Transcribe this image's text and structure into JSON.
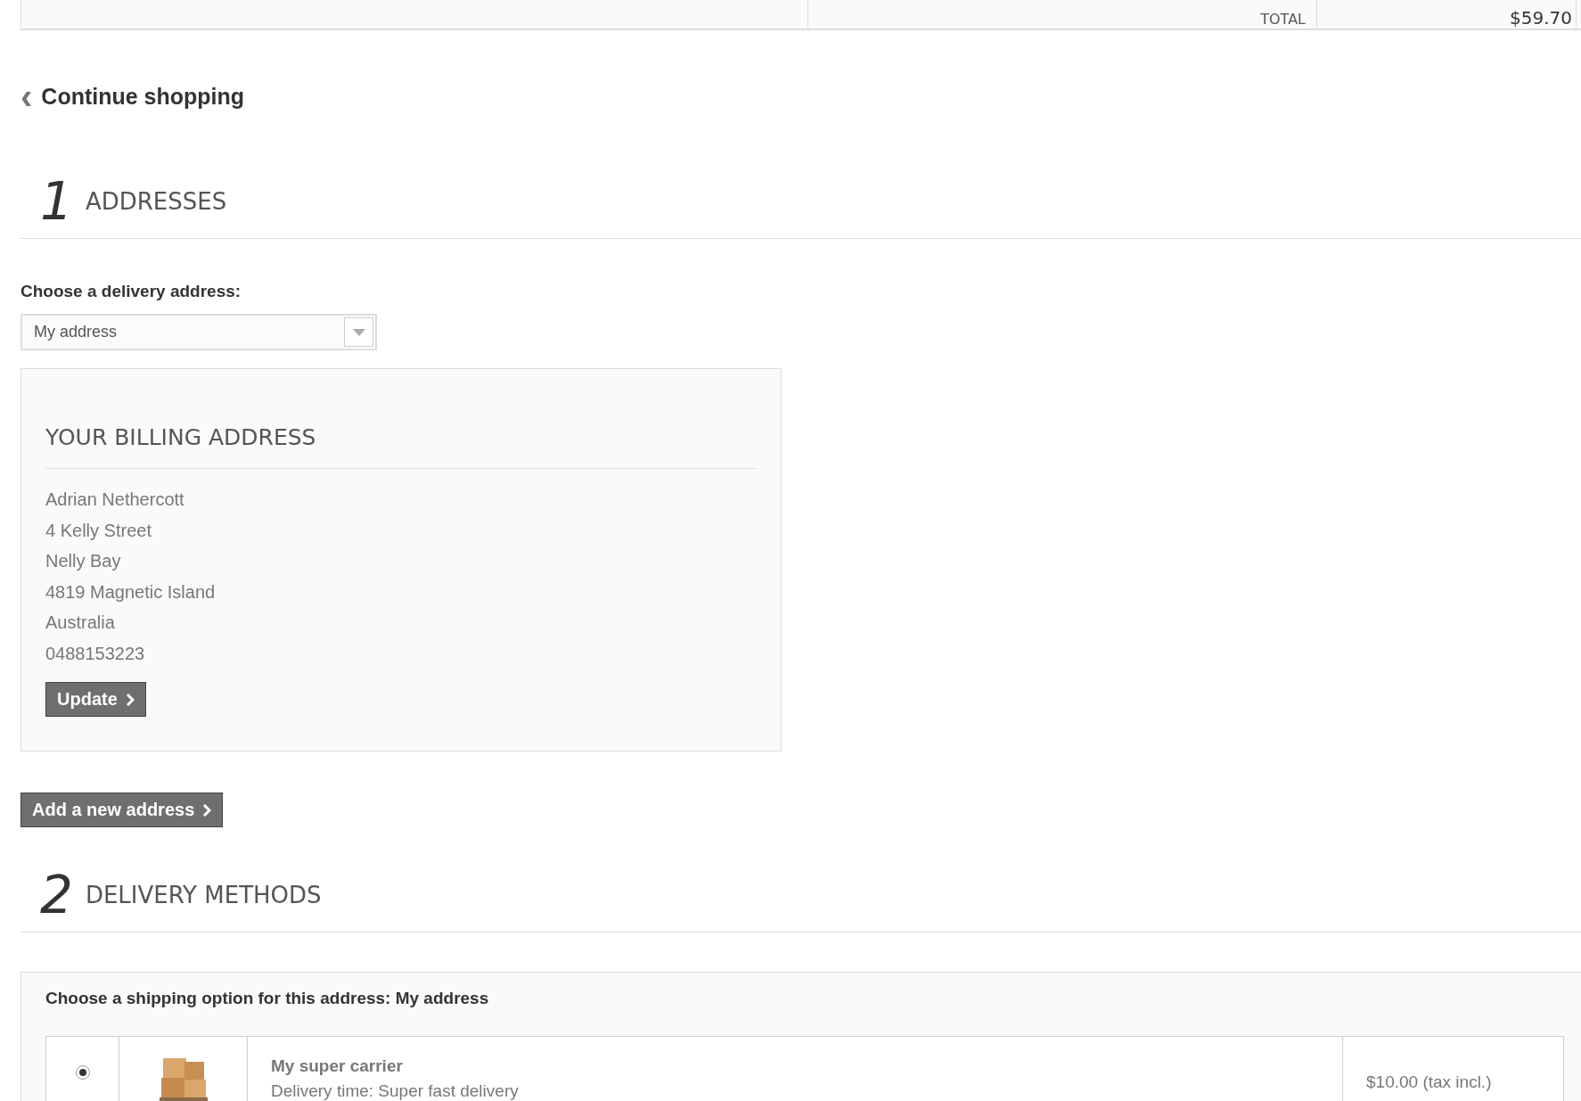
{
  "summary_row": {
    "label": "TOTAL",
    "value": "$59.70"
  },
  "continue_link": {
    "icon": "‹",
    "label": "Continue shopping"
  },
  "steps": [
    {
      "number": "1",
      "title": "ADDRESSES"
    },
    {
      "number": "2",
      "title": "DELIVERY METHODS"
    }
  ],
  "addresses": {
    "label": "Choose a delivery address:",
    "select_value": "My address",
    "billing": {
      "title": "YOUR BILLING ADDRESS",
      "lines": [
        "Adrian Nethercott",
        "4 Kelly Street",
        "Nelly Bay",
        "4819 Magnetic Island",
        "Australia",
        "0488153223"
      ],
      "button": "Update"
    },
    "add_button": "Add a new address"
  },
  "delivery": {
    "heading": "Choose a shipping option for this address: My address",
    "options": [
      {
        "selected": true,
        "name": "My super carrier",
        "delivery_time": "Delivery time: Super fast delivery",
        "price": "$10.00 (tax incl.)"
      }
    ]
  }
}
